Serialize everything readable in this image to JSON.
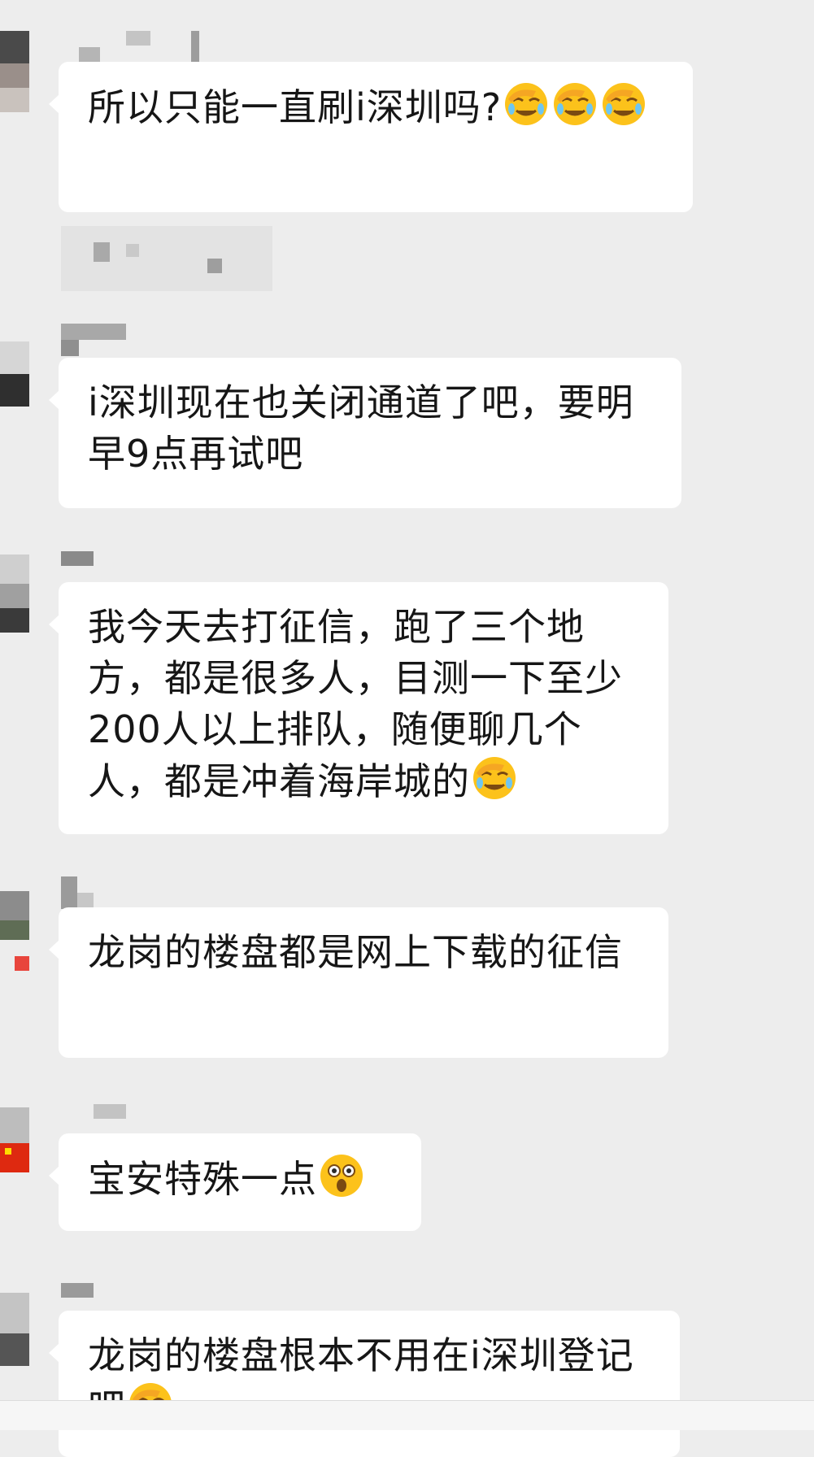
{
  "chat": {
    "messages": [
      {
        "text": "所以只能一直刷i深圳吗?",
        "emoji": [
          "facepalm-crying",
          "facepalm-crying",
          "facepalm-crying"
        ]
      },
      {
        "text": "i深圳现在也关闭通道了吧，要明早9点再试吧",
        "emoji": []
      },
      {
        "text": "我今天去打征信，跑了三个地方，都是很多人，目测一下至少200人以上排队，随便聊几个人，都是冲着海岸城的",
        "emoji": [
          "facepalm-crying"
        ]
      },
      {
        "text": "龙岗的楼盘都是网上下载的征信",
        "emoji": []
      },
      {
        "text": "宝安特殊一点",
        "emoji": [
          "shocked-face"
        ]
      },
      {
        "text": "龙岗的楼盘根本不用在i深圳登记吧",
        "emoji": [
          "facepalm-crying"
        ]
      }
    ]
  },
  "colors": {
    "background": "#ededed",
    "bubble": "#ffffff",
    "text": "#161616",
    "emoji_face": "#fcc21b"
  }
}
